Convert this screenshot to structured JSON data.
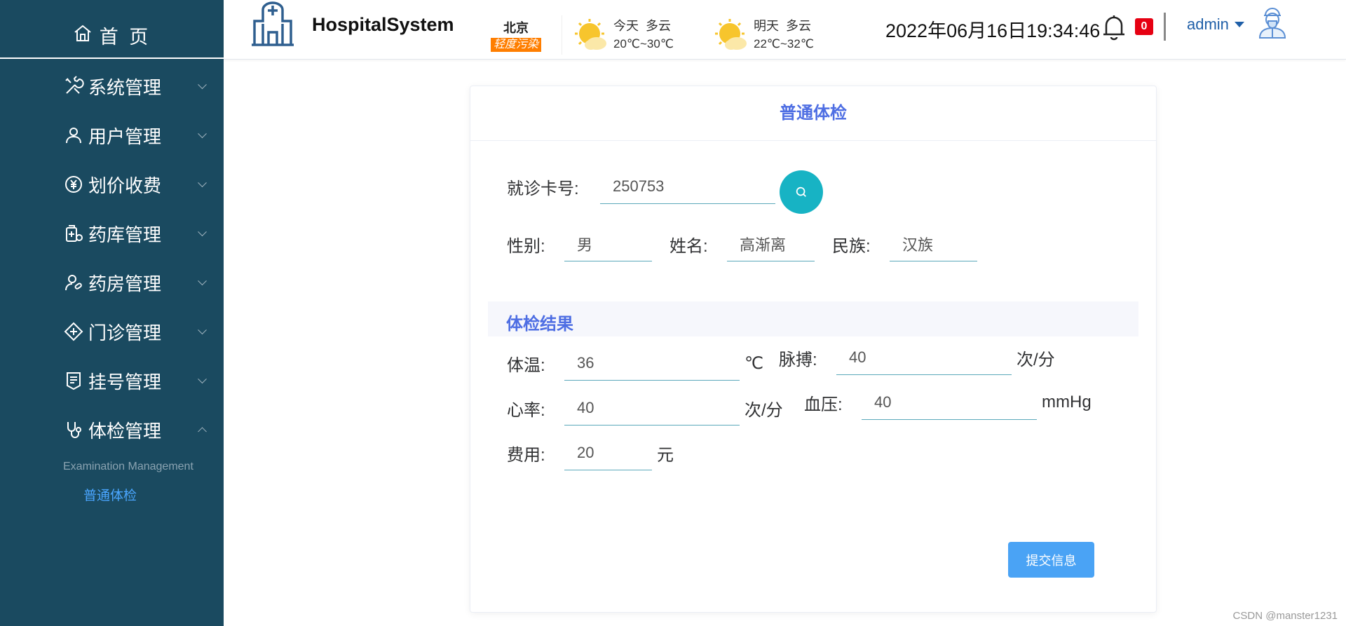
{
  "sidebar": {
    "home_label": "首 页",
    "items": [
      {
        "label": "系统管理",
        "icon": "tools-icon"
      },
      {
        "label": "用户管理",
        "icon": "user-icon"
      },
      {
        "label": "划价收费",
        "icon": "yen-icon"
      },
      {
        "label": "药库管理",
        "icon": "medicine-storage-icon"
      },
      {
        "label": "药房管理",
        "icon": "pharmacy-icon"
      },
      {
        "label": "门诊管理",
        "icon": "clinic-icon"
      },
      {
        "label": "挂号管理",
        "icon": "register-icon"
      },
      {
        "label": "体检管理",
        "icon": "stethoscope-icon"
      }
    ],
    "submenu_title": "Examination Management",
    "submenu_item": "普通体检"
  },
  "header": {
    "app_title": "HospitalSystem",
    "city": "北京",
    "air_quality": "轻度污染",
    "weather_today": {
      "day": "今天",
      "cond": "多云",
      "temp": "20℃~30℃",
      "icon": "partly-cloudy-icon"
    },
    "weather_tomorrow": {
      "day": "明天",
      "cond": "多云",
      "temp": "22℃~32℃",
      "icon": "partly-cloudy-icon"
    },
    "datetime": "2022年06月16日19:34:46",
    "notification_count": "0",
    "username": "admin"
  },
  "card": {
    "title": "普通体检",
    "card_no_label": "就诊卡号:",
    "card_no_value": "250753",
    "gender_label": "性别:",
    "gender_value": "男",
    "name_label": "姓名:",
    "name_value": "高渐离",
    "ethnicity_label": "民族:",
    "ethnicity_value": "汉族",
    "section_title": "体检结果",
    "temperature_label": "体温:",
    "temperature_value": "36",
    "temperature_unit": "℃",
    "pulse_label": "脉搏:",
    "pulse_value": "40",
    "pulse_unit": "次/分",
    "heart_rate_label": "心率:",
    "heart_rate_value": "40",
    "heart_rate_unit": "次/分",
    "blood_pressure_label": "血压:",
    "blood_pressure_value": "40",
    "blood_pressure_unit": "mmHg",
    "fee_label": "费用:",
    "fee_value": "20",
    "fee_unit": "元",
    "submit_label": "提交信息"
  },
  "watermark": "CSDN @manster1231",
  "colors": {
    "sidebar_bg": "#1a4a60",
    "accent": "#4e6ee3",
    "search_button": "#17b3c4",
    "submit_button": "#4aa3f5",
    "badge": "#e60012",
    "aqi": "#ff7e00"
  }
}
